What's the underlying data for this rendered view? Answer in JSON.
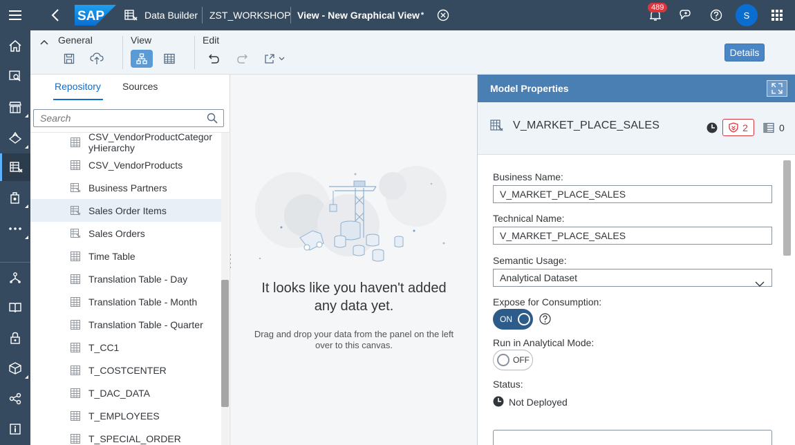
{
  "shell": {
    "app_name": "Data Builder",
    "space": "ZST_WORKSHOP",
    "view_title": "View - New Graphical View",
    "modified_marker": "*",
    "notifications_count": "489",
    "avatar_initial": "S"
  },
  "toolbar": {
    "general_label": "General",
    "view_label": "View",
    "edit_label": "Edit",
    "details_label": "Details"
  },
  "left_panel": {
    "tabs": [
      {
        "label": "Repository"
      },
      {
        "label": "Sources"
      }
    ],
    "search_placeholder": "Search",
    "items": [
      {
        "label_line1": "CSV_VendorProductCategor",
        "label_line2": "yHierarchy",
        "icon": "table-icon"
      },
      {
        "label": "CSV_VendorProducts",
        "icon": "table-icon"
      },
      {
        "label": "Business Partners",
        "icon": "view-icon"
      },
      {
        "label": "Sales Order Items",
        "icon": "view-icon",
        "selected": true
      },
      {
        "label": "Sales Orders",
        "icon": "view-icon"
      },
      {
        "label": "Time Table",
        "icon": "table-icon"
      },
      {
        "label": "Translation Table - Day",
        "icon": "table-icon"
      },
      {
        "label": "Translation Table - Month",
        "icon": "table-icon"
      },
      {
        "label": "Translation Table - Quarter",
        "icon": "table-icon"
      },
      {
        "label": "T_CC1",
        "icon": "table-icon"
      },
      {
        "label": "T_COSTCENTER",
        "icon": "table-icon"
      },
      {
        "label": "T_DAC_DATA",
        "icon": "table-icon"
      },
      {
        "label": "T_EMPLOYEES",
        "icon": "table-icon"
      },
      {
        "label": "T_SPECIAL_ORDER",
        "icon": "table-icon"
      }
    ]
  },
  "canvas": {
    "empty_title_line1": "It looks like you haven't added",
    "empty_title_line2": "any data yet.",
    "empty_sub_line1": "Drag and drop your data from the panel on the left",
    "empty_sub_line2": "over to this canvas."
  },
  "properties": {
    "header": "Model Properties",
    "object_name": "V_MARKET_PLACE_SALES",
    "issues_count": "2",
    "columns_count": "0",
    "business_name_label": "Business Name:",
    "business_name": "V_MARKET_PLACE_SALES",
    "technical_name_label": "Technical Name:",
    "technical_name": "V_MARKET_PLACE_SALES",
    "semantic_usage_label": "Semantic Usage:",
    "semantic_usage": "Analytical Dataset",
    "expose_label": "Expose for Consumption:",
    "expose_state": "ON",
    "analytical_mode_label": "Run in Analytical Mode:",
    "analytical_mode_state": "OFF",
    "status_label": "Status:",
    "status_value": "Not Deployed"
  },
  "colors": {
    "shell": "#354a5f",
    "accent": "#0a6ed1",
    "panel_header": "#4a7fb3",
    "badge": "#d9363e"
  }
}
